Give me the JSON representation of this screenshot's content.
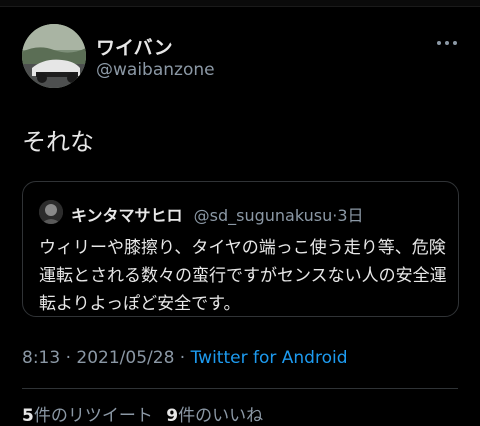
{
  "tweet": {
    "author_name": "ワイバン",
    "author_handle": "@waibanzone",
    "text": "それな",
    "time": "8:13",
    "date": "2021/05/28",
    "dot": "·",
    "source": "Twitter for Android"
  },
  "quote": {
    "name": "キンタマサヒロ",
    "handle": "@sd_sugunakusu",
    "dot": "·",
    "time": "3日",
    "text": "ウィリーや膝擦り、タイヤの端っこ使う走り等、危険運転とされる数々の蛮行ですがセンスない人の安全運転よりよっぽど安全です。"
  },
  "stats": {
    "retweets_count": "5",
    "retweets_label": "件のリツイート",
    "likes_count": "9",
    "likes_label": "件のいいね"
  },
  "icons": {
    "more": "more-horizontal-icon"
  },
  "colors": {
    "background": "#000000",
    "text": "#e7e7e7",
    "secondary": "#8b98a5",
    "link": "#1d9bf0",
    "border": "#303336"
  }
}
